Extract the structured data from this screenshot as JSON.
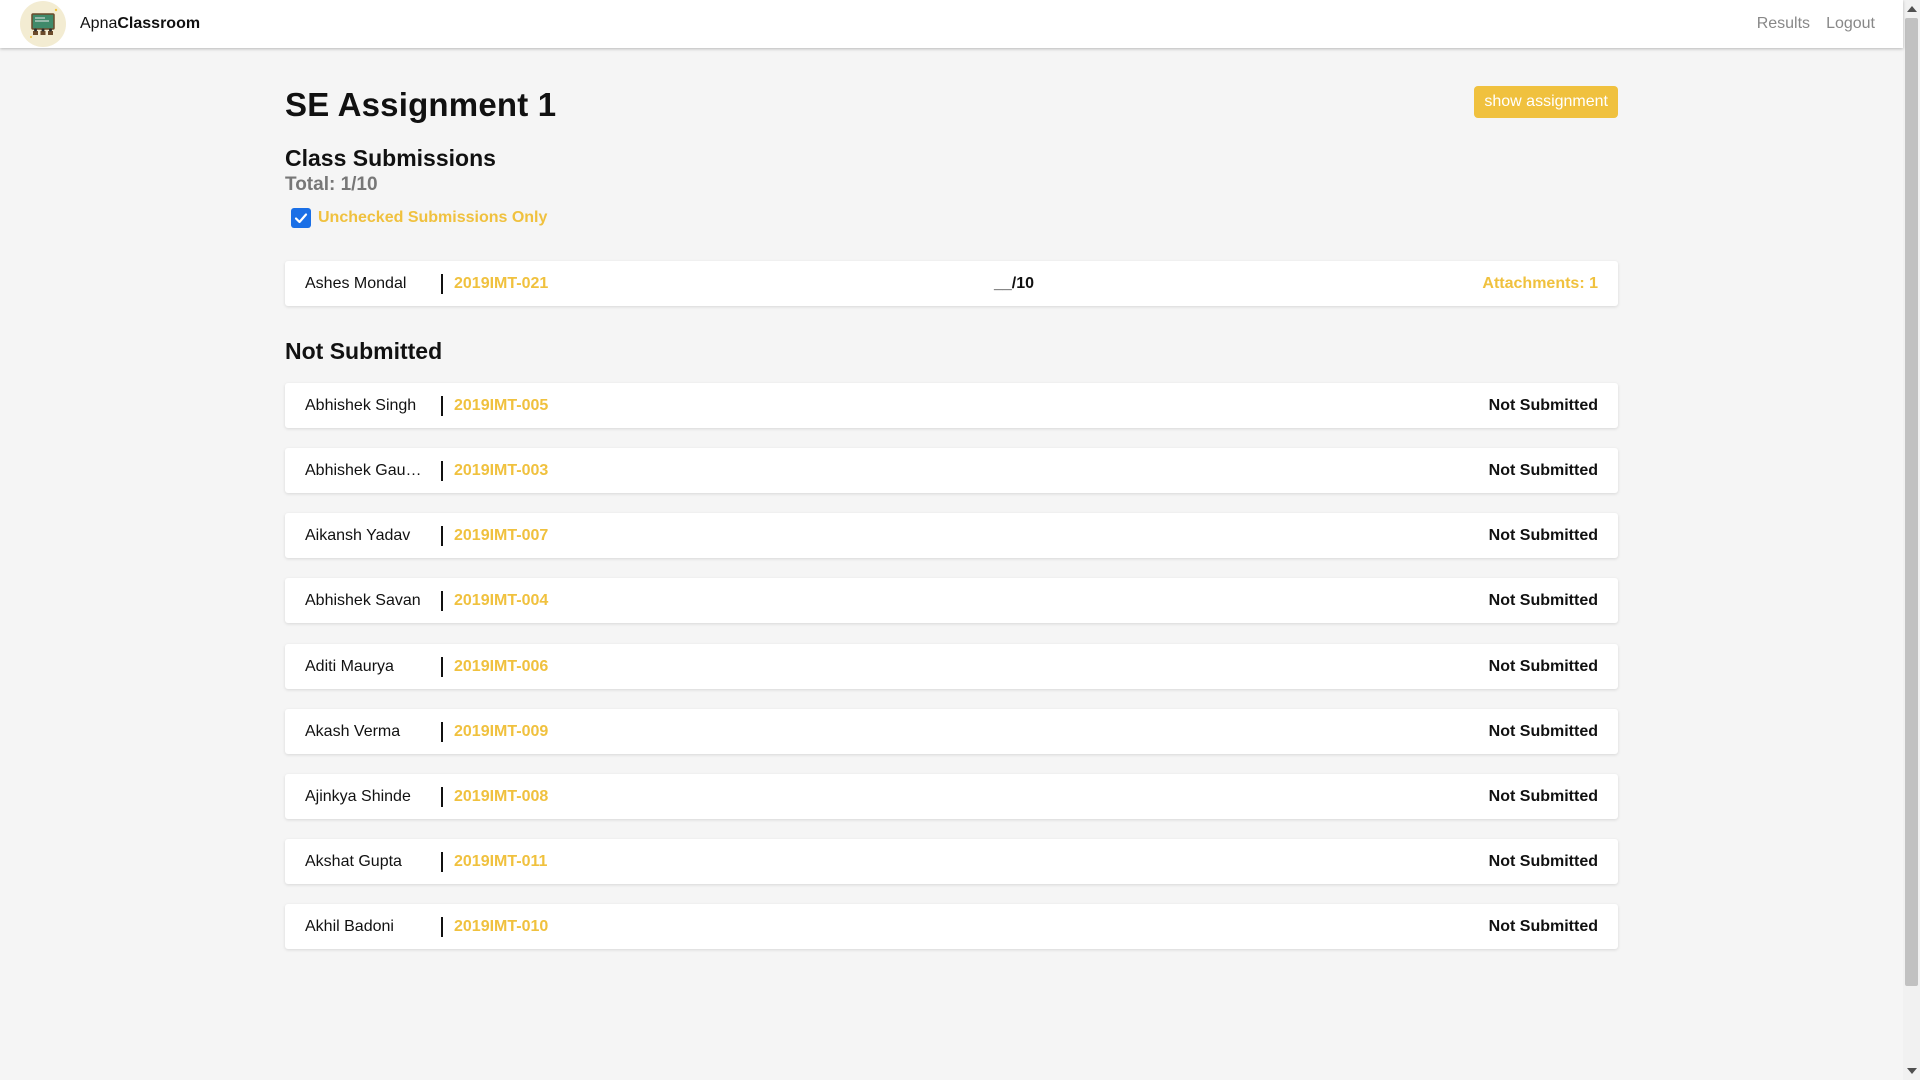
{
  "navbar": {
    "brand_prefix": "Apna",
    "brand_bold": "Classroom",
    "links": [
      "Results",
      "Logout"
    ]
  },
  "assignment": {
    "title": "SE Assignment 1",
    "show_button": "show assignment"
  },
  "submissions": {
    "heading": "Class Submissions",
    "total": "Total: 1/10",
    "filter_label": "Unchecked Submissions Only",
    "filter_checked": true,
    "rows": [
      {
        "name": "Ashes Mondal",
        "roll": "2019IMT-021",
        "grade": "__/10",
        "attachments": "Attachments: 1"
      }
    ]
  },
  "not_submitted": {
    "heading": "Not Submitted",
    "status_label": "Not Submitted",
    "rows": [
      {
        "name": "Abhishek Singh",
        "roll": "2019IMT-005",
        "status": "Not Submitted"
      },
      {
        "name": "Abhishek Gaut...",
        "roll": "2019IMT-003",
        "status": "Not Submitted"
      },
      {
        "name": "Aikansh Yadav",
        "roll": "2019IMT-007",
        "status": "Not Submitted"
      },
      {
        "name": "Abhishek Savan",
        "roll": "2019IMT-004",
        "status": "Not Submitted"
      },
      {
        "name": "Aditi Maurya",
        "roll": "2019IMT-006",
        "status": "Not Submitted"
      },
      {
        "name": "Akash Verma",
        "roll": "2019IMT-009",
        "status": "Not Submitted"
      },
      {
        "name": "Ajinkya Shinde",
        "roll": "2019IMT-008",
        "status": "Not Submitted"
      },
      {
        "name": "Akshat Gupta",
        "roll": "2019IMT-011",
        "status": "Not Submitted"
      },
      {
        "name": "Akhil Badoni",
        "roll": "2019IMT-010",
        "status": "Not Submitted"
      }
    ]
  },
  "colors": {
    "accent": "#f0c13e",
    "checkbox": "#1a6fe6",
    "background": "#f5f5f5"
  },
  "icons": [
    "classroom-logo-icon",
    "checkmark-icon"
  ]
}
